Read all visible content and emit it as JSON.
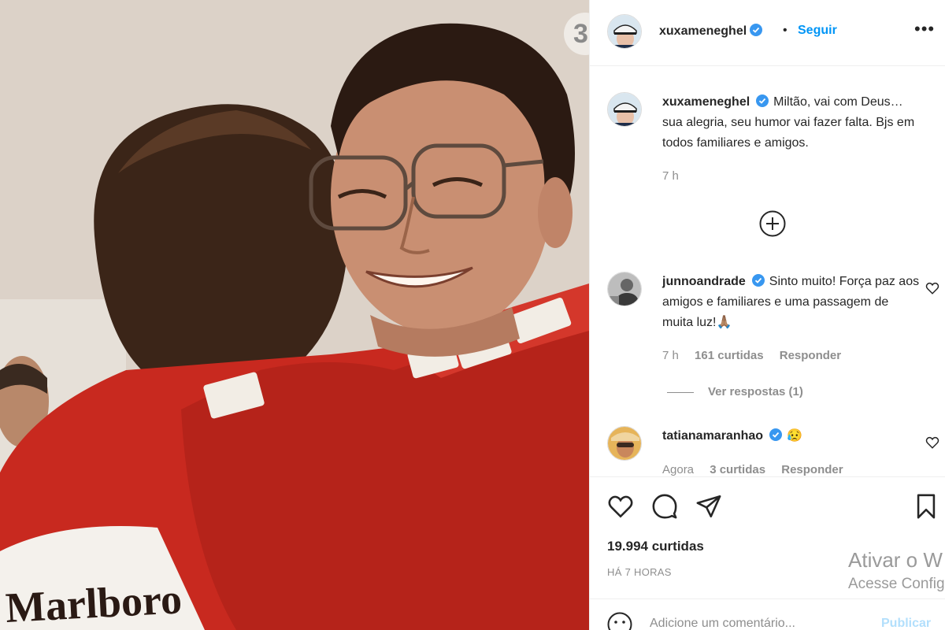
{
  "photo": {
    "description_icon": "photo",
    "carousel_indicator": "3"
  },
  "post": {
    "author": "xuxameneghel",
    "follow_label": "Seguir",
    "separator": "•",
    "more_icon": "more-options-icon",
    "more_label": "•••"
  },
  "comments": [
    {
      "username": "xuxameneghel",
      "text": "Miltão, vai com Deus… sua alegria, seu humor vai fazer falta. Bjs em todos familiares e amigos.",
      "time": "7 h"
    },
    {
      "username": "junnoandrade",
      "text": "Sinto muito! Força paz aos amigos e familiares e uma passagem de muita luz!🙏🏽",
      "time": "7 h",
      "likes": "161 curtidas",
      "reply_label": "Responder",
      "view_replies": "Ver respostas (1)"
    },
    {
      "username": "tatianamaranhao",
      "text": "😥",
      "time": "Agora",
      "likes": "3 curtidas",
      "reply_label": "Responder"
    }
  ],
  "actions": {
    "likes_count": "19.994 curtidas",
    "posted_ago": "HÁ 7 HORAS"
  },
  "windows_watermark": {
    "line1": "Ativar o W",
    "line2": "Acesse Config"
  },
  "add_comment": {
    "placeholder": "Adicione um comentário...",
    "post_label": "Publicar"
  },
  "colors": {
    "link_blue": "#0095f6",
    "post_disabled": "#b2dffc",
    "secondary_text": "#8e8e8e",
    "suit_red": "#c8291f"
  }
}
